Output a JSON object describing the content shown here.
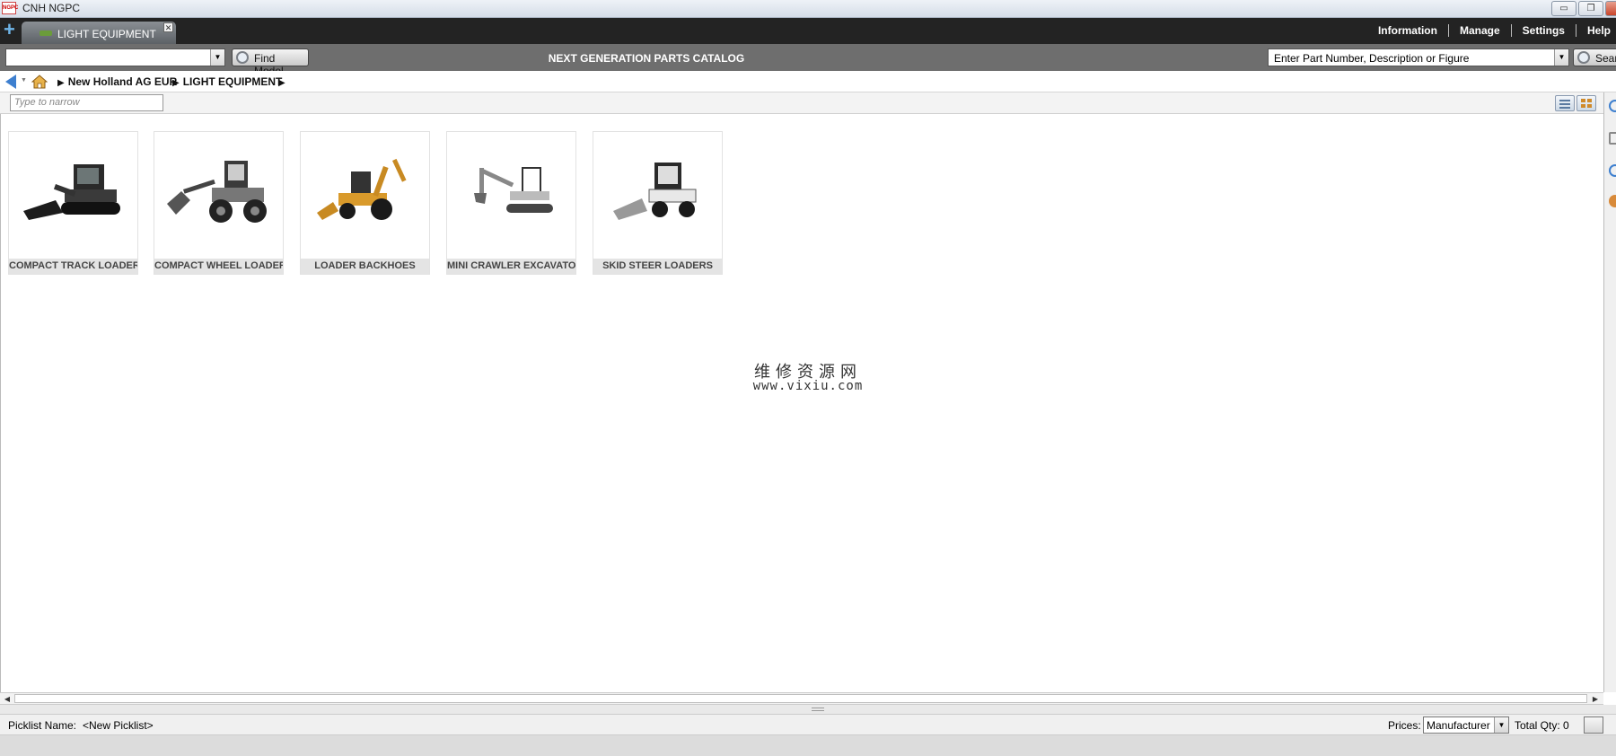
{
  "window": {
    "title": "CNH NGPC",
    "app_icon_text": "NGPC"
  },
  "tabs": [
    {
      "label": "LIGHT EQUIPMENT"
    }
  ],
  "top_menu": [
    "Information",
    "Manage",
    "Settings",
    "Help"
  ],
  "toolbar": {
    "model_value": "",
    "find_model_label": "Find Model",
    "catalog_title": "NEXT GENERATION PARTS CATALOG",
    "search_placeholder": "Enter Part Number, Description or Figure",
    "search_label": "Search"
  },
  "breadcrumb": [
    "New Holland AG EUR",
    "LIGHT EQUIPMENT"
  ],
  "filter": {
    "placeholder": "Type to narrow"
  },
  "categories": [
    {
      "label": "COMPACT TRACK LOADERS",
      "icon": "compact-track-loader-image"
    },
    {
      "label": "COMPACT WHEEL LOADERS",
      "icon": "compact-wheel-loader-image"
    },
    {
      "label": "LOADER BACKHOES",
      "icon": "loader-backhoe-image"
    },
    {
      "label": "MINI CRAWLER EXCAVATOR",
      "icon": "mini-excavator-image"
    },
    {
      "label": "SKID STEER LOADERS",
      "icon": "skid-steer-loader-image"
    }
  ],
  "watermark": {
    "cn": "维修资源网",
    "url": "www.vixiu.com"
  },
  "status": {
    "picklist_label": "Picklist Name:",
    "picklist_value": "<New Picklist>",
    "prices_label": "Prices:",
    "prices_value": "Manufacturer",
    "total_qty": "Total Qty: 0"
  },
  "colors": {
    "tabbar": "#232323",
    "toolbar": "#6e6e6e",
    "accent_blue": "#3d7fcf"
  }
}
